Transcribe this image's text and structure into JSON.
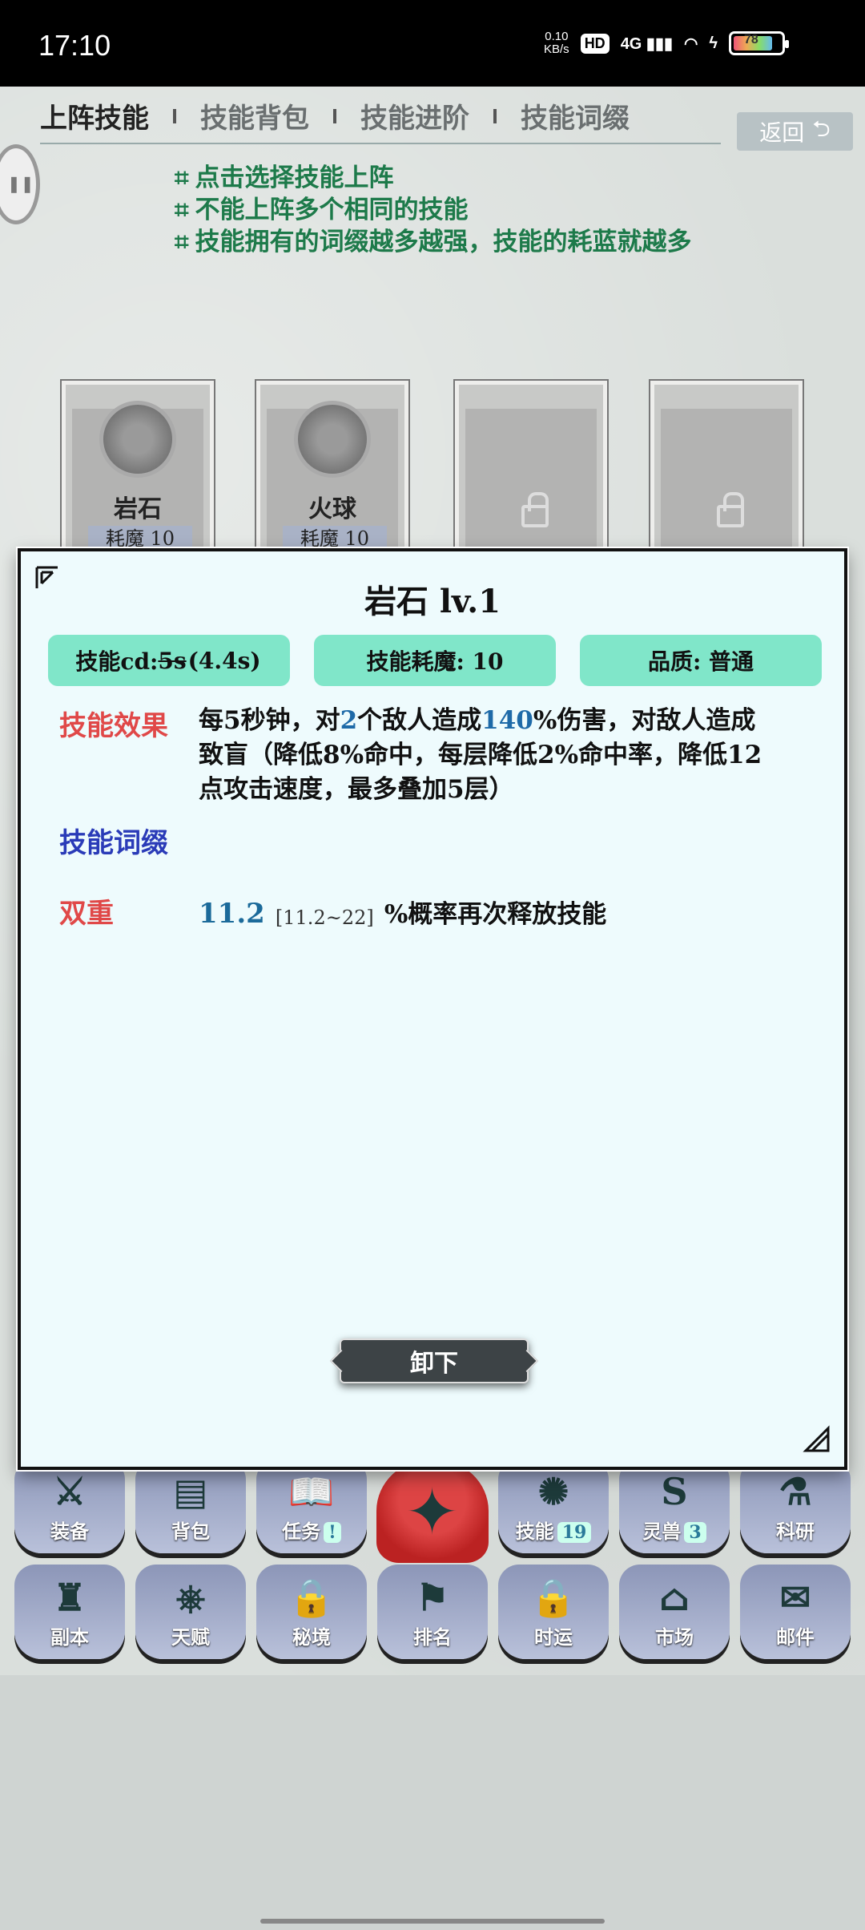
{
  "status_bar": {
    "time": "17:10",
    "net_speed_value": "0.10",
    "net_speed_unit": "KB/s",
    "hd": "HD",
    "network": "4G",
    "battery_level": "78"
  },
  "tabs": [
    {
      "label": "上阵技能",
      "active": true
    },
    {
      "label": "技能背包",
      "active": false
    },
    {
      "label": "技能进阶",
      "active": false
    },
    {
      "label": "技能词缀",
      "active": false
    }
  ],
  "back_label": "返回",
  "tips": [
    "点击选择技能上阵",
    "不能上阵多个相同的技能",
    "技能拥有的词缀越多越强，技能的耗蓝就越多"
  ],
  "tip_bullet": "⌗",
  "slots": [
    {
      "name": "岩石",
      "cost": "耗魔 10",
      "locked": false
    },
    {
      "name": "火球",
      "cost": "耗魔 10",
      "locked": false
    },
    {
      "locked": true
    },
    {
      "locked": true
    }
  ],
  "modal": {
    "title": "岩石 lv.1",
    "pills": {
      "cd_label": "技能cd:",
      "cd_original": "5s",
      "cd_current": "(4.4s)",
      "cost": "技能耗魔: 10",
      "quality": "品质: 普通"
    },
    "effect_label": "技能效果",
    "effect_text": {
      "p1": "每5秒钟，对",
      "targets": "2",
      "p2": "个敌人造成",
      "damage": "140",
      "p3": "%伤害，对敌人造成致盲（降低8%命中，每层降低2%命中率，降低12点攻击速度，最多叠加5层）"
    },
    "affix_label": "技能词缀",
    "affix": {
      "name": "双重",
      "value": "11.2",
      "range": "[11.2~22]",
      "desc": "%概率再次释放技能"
    },
    "unequip_label": "卸下"
  },
  "nav": [
    {
      "label": "装备",
      "icon": "sword-icon",
      "badge": ""
    },
    {
      "label": "背包",
      "icon": "bag-icon",
      "badge": ""
    },
    {
      "label": "任务",
      "icon": "book-icon",
      "badge": "!"
    },
    {
      "label": "技能",
      "icon": "skill-icon",
      "badge": "19"
    },
    {
      "label": "灵兽",
      "icon": "serpent-icon",
      "badge": "3"
    },
    {
      "label": "科研",
      "icon": "research-icon",
      "badge": ""
    },
    {
      "label": "副本",
      "icon": "tower-icon",
      "badge": ""
    },
    {
      "label": "天赋",
      "icon": "wheel-icon",
      "badge": ""
    },
    {
      "label": "秘境",
      "icon": "lock-icon",
      "badge": ""
    },
    {
      "label": "排名",
      "icon": "banner-icon",
      "badge": ""
    },
    {
      "label": "时运",
      "icon": "lock-icon",
      "badge": ""
    },
    {
      "label": "市场",
      "icon": "shop-icon",
      "badge": ""
    },
    {
      "label": "邮件",
      "icon": "mail-icon",
      "badge": ""
    }
  ],
  "colors": {
    "accent_green": "#80e6c9",
    "effect_red": "#e04848",
    "affix_blue": "#2a3bb8",
    "highlight_blue": "#1e6aa8",
    "tip_green": "#1d7a4a"
  }
}
